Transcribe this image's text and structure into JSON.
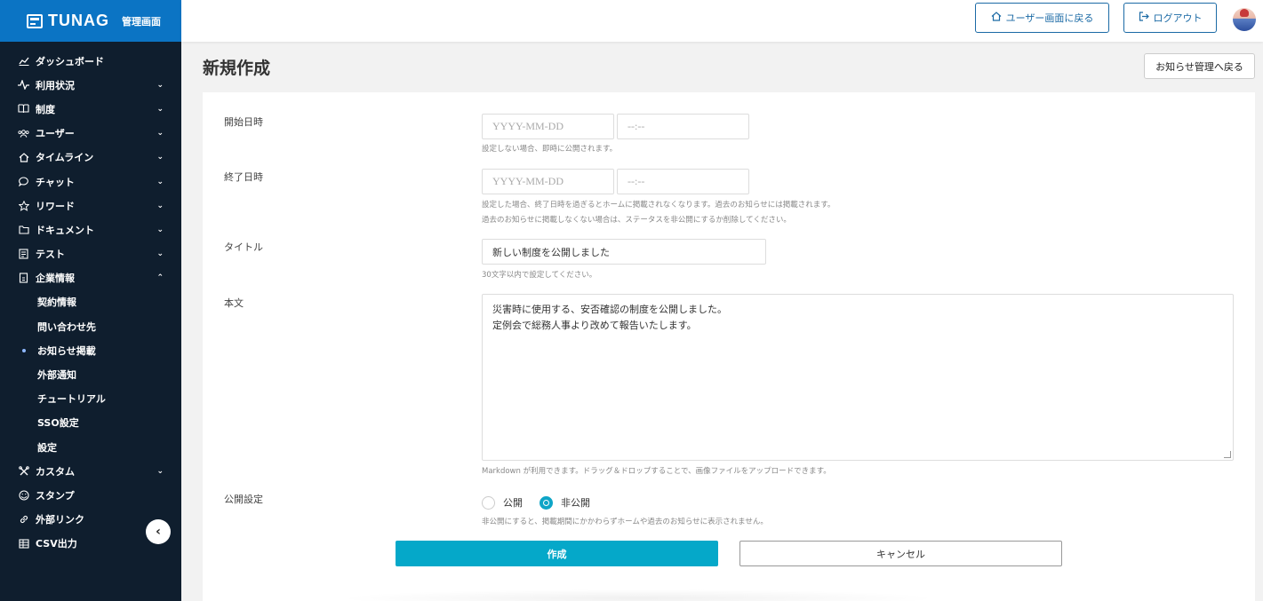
{
  "brand": {
    "name": "TUNAG",
    "sub": "管理画面"
  },
  "header": {
    "user_screen_label": "ユーザー画面に戻る",
    "logout_label": "ログアウト"
  },
  "sidebar": {
    "items": [
      {
        "label": "ダッシュボード",
        "icon": "chart-icon",
        "chevron": ""
      },
      {
        "label": "利用状況",
        "icon": "pulse-icon",
        "chevron": "⌄"
      },
      {
        "label": "制度",
        "icon": "book-icon",
        "chevron": "⌄"
      },
      {
        "label": "ユーザー",
        "icon": "users-icon",
        "chevron": "⌄"
      },
      {
        "label": "タイムライン",
        "icon": "home-icon",
        "chevron": "⌄"
      },
      {
        "label": "チャット",
        "icon": "chat-icon",
        "chevron": "⌄"
      },
      {
        "label": "リワード",
        "icon": "star-icon",
        "chevron": "⌄"
      },
      {
        "label": "ドキュメント",
        "icon": "folder-icon",
        "chevron": "⌄"
      },
      {
        "label": "テスト",
        "icon": "clipboard-icon",
        "chevron": "⌄"
      },
      {
        "label": "企業情報",
        "icon": "building-icon",
        "chevron": "⌃"
      }
    ],
    "subitems": [
      {
        "label": "契約情報"
      },
      {
        "label": "問い合わせ先"
      },
      {
        "label": "お知らせ掲載"
      },
      {
        "label": "外部通知"
      },
      {
        "label": "チュートリアル"
      },
      {
        "label": "SSO設定"
      },
      {
        "label": "設定"
      }
    ],
    "items_after": [
      {
        "label": "カスタム",
        "icon": "tools-icon",
        "chevron": "⌄"
      },
      {
        "label": "スタンプ",
        "icon": "smile-icon",
        "chevron": ""
      },
      {
        "label": "外部リンク",
        "icon": "link-icon",
        "chevron": ""
      },
      {
        "label": "CSV出力",
        "icon": "table-icon",
        "chevron": ""
      }
    ],
    "collapse_glyph": "‹"
  },
  "page": {
    "title": "新規作成",
    "back_label": "お知らせ管理へ戻る"
  },
  "form": {
    "start": {
      "label": "開始日時",
      "date_placeholder": "YYYY-MM-DD",
      "time_placeholder": "--:--",
      "hint": "設定しない場合、即時に公開されます。"
    },
    "end": {
      "label": "終了日時",
      "date_placeholder": "YYYY-MM-DD",
      "time_placeholder": "--:--",
      "hint1": "設定した場合、終了日時を過ぎるとホームに掲載されなくなります。過去のお知らせには掲載されます。",
      "hint2": "過去のお知らせに掲載しなくない場合は、ステータスを非公開にするか削除してください。"
    },
    "title": {
      "label": "タイトル",
      "value": "新しい制度を公開しました",
      "hint": "30文字以内で設定してください。"
    },
    "body": {
      "label": "本文",
      "line1": "災害時に使用する、安否確認の制度を公開しました。",
      "line2": "定例会で総務人事より改めて報告いたします。",
      "hint": "Markdown が利用できます。ドラッグ＆ドロップすることで、画像ファイルをアップロードできます。"
    },
    "visibility": {
      "label": "公開設定",
      "option_public": "公開",
      "option_private": "非公開",
      "selected": "非公開",
      "hint": "非公開にすると、掲載期間にかかわらずホームや過去のお知らせに表示されません。"
    },
    "create_label": "作成",
    "cancel_label": "キャンセル"
  },
  "colors": {
    "brand_blue": "#0b74c4",
    "sidebar_bg": "#0f1e2e",
    "primary": "#05a8c9",
    "link": "#1b6aa5"
  }
}
